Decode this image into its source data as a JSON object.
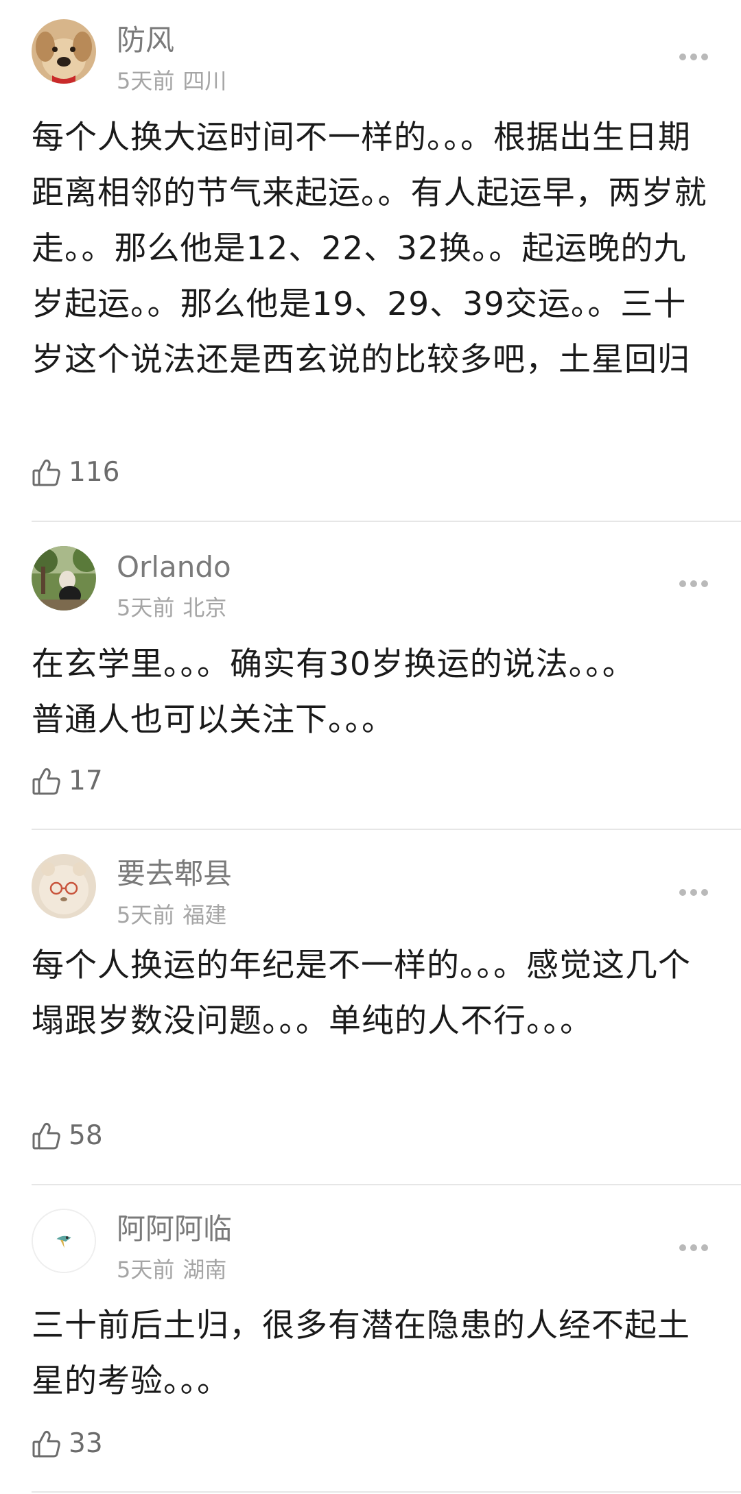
{
  "comments": [
    {
      "username": "防风",
      "time": "5天前",
      "location": "四川",
      "text": "每个人换大运时间不一样的。。。根据出生日期距离相邻的节气来起运。。有人起运早，两岁就走。。那么他是12、22、32换。。起运晚的九岁起运。。那么他是19、29、39交运。。三十岁这个说法还是西玄说的比较多吧，土星回归",
      "likes": "116",
      "avatar_icon": "dog-avatar-icon"
    },
    {
      "username": "Orlando",
      "time": "5天前",
      "location": "北京",
      "text": "在玄学里。。。确实有30岁换运的说法。。。普通人也可以关注下。。。",
      "likes": "17",
      "avatar_icon": "park-photo-avatar-icon"
    },
    {
      "username": "要去郫县",
      "time": "5天前",
      "location": "福建",
      "text": "每个人换运的年纪是不一样的。。。感觉这几个塌跟岁数没问题。。。单纯的人不行。。。",
      "likes": "58",
      "avatar_icon": "bear-glasses-avatar-icon"
    },
    {
      "username": "阿阿阿临",
      "time": "5天前",
      "location": "湖南",
      "text": "三十前后土归，很多有潜在隐患的人经不起土星的考验。。。",
      "likes": "33",
      "avatar_icon": "bird-avatar-icon"
    }
  ],
  "colors": {
    "username": "#7a7a7a",
    "meta": "#a5a5a5",
    "text": "#1a1a1a",
    "divider": "#e6e6e6"
  }
}
